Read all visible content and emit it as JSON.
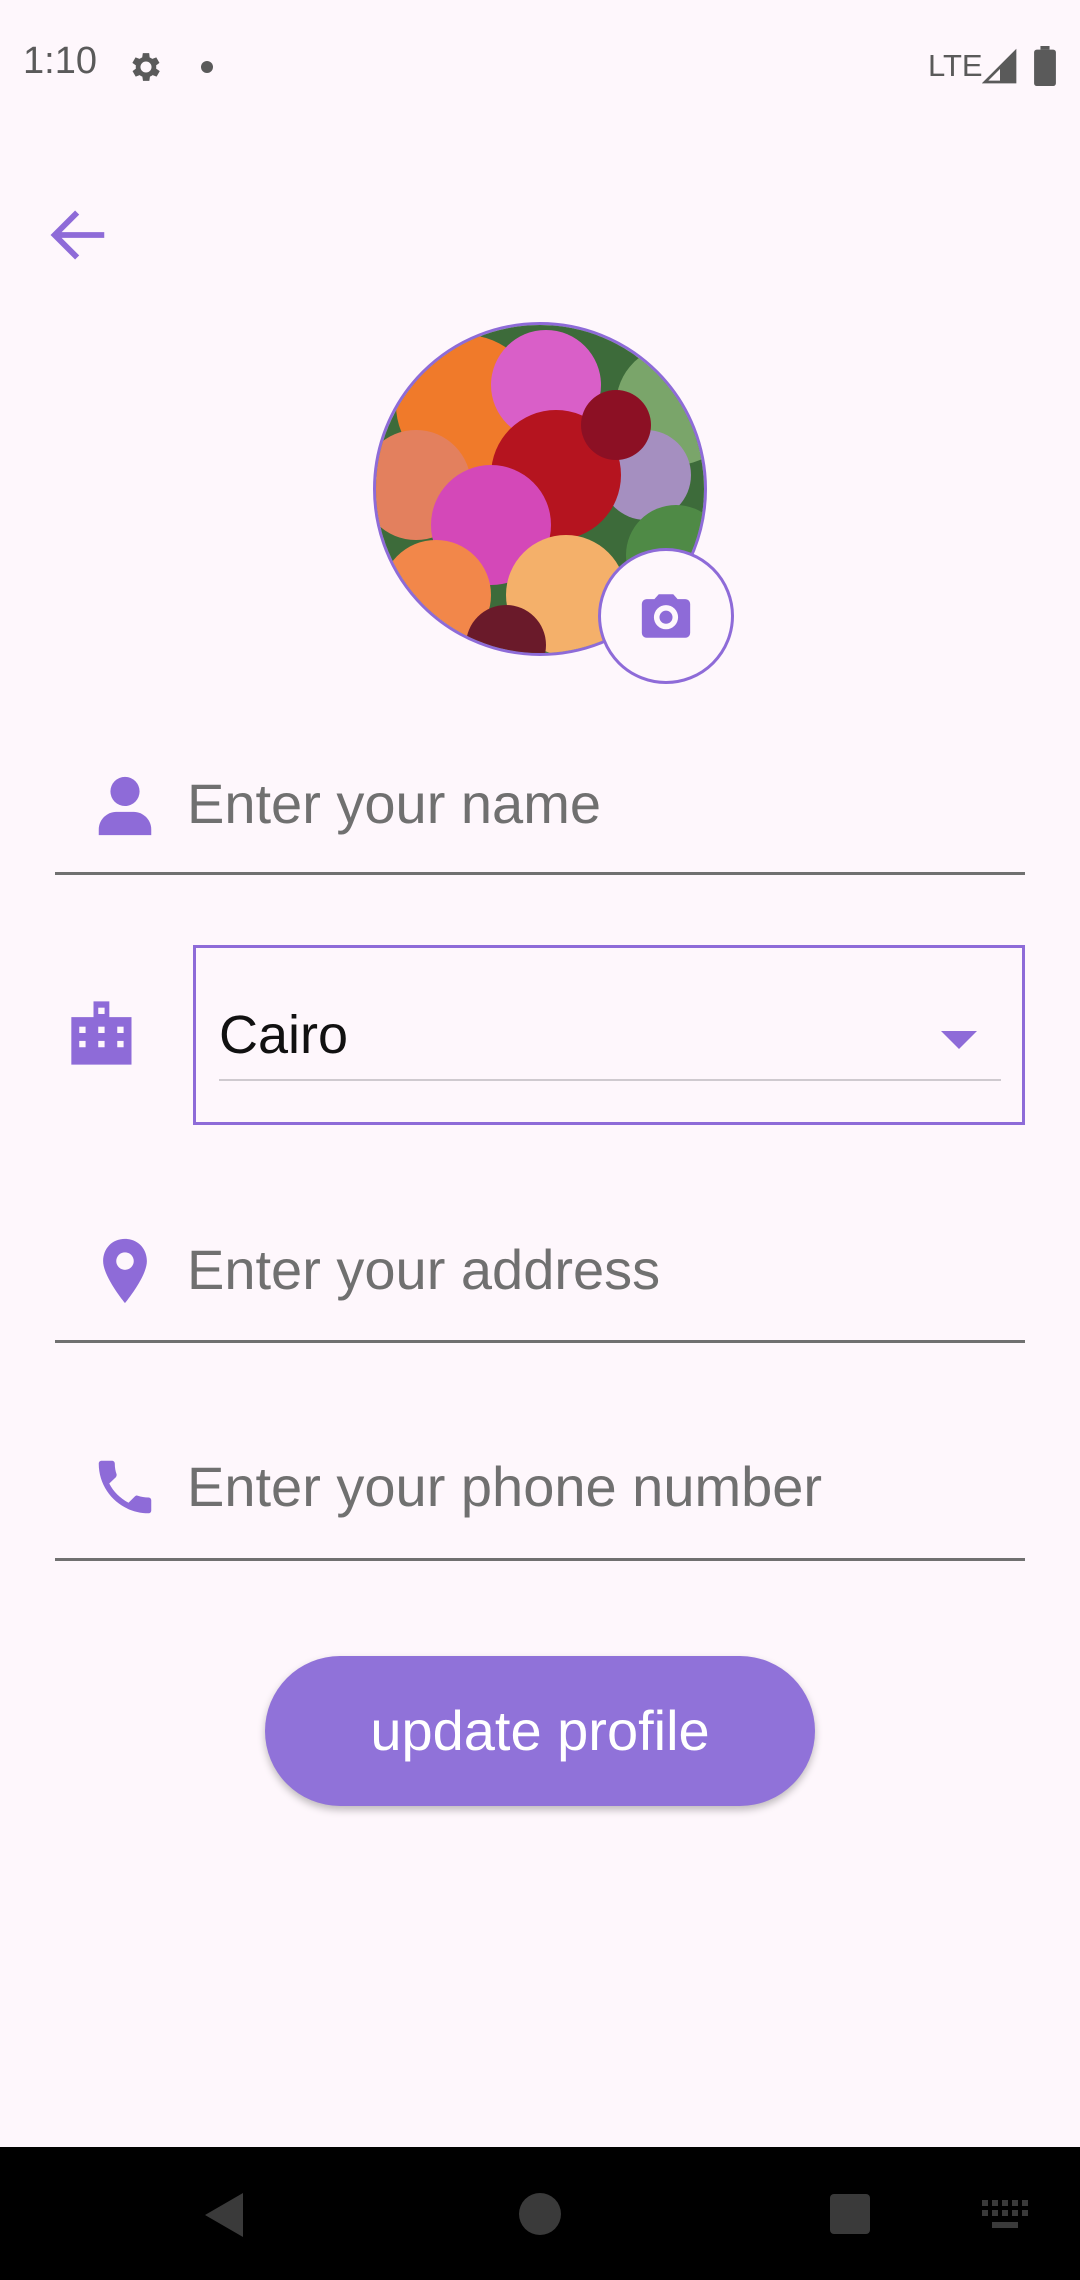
{
  "status_bar": {
    "time": "1:10",
    "network": "LTE",
    "icons": [
      "gear-icon",
      "dot-icon",
      "signal-icon",
      "battery-icon"
    ]
  },
  "header": {
    "back_icon": "arrow-left-icon"
  },
  "avatar": {
    "description_icon": "camera-icon"
  },
  "form": {
    "name_placeholder": "Enter your name",
    "city_value": "Cairo",
    "address_placeholder": "Enter your address",
    "phone_placeholder": "Enter your phone number"
  },
  "actions": {
    "update_label": "update profile"
  },
  "colors": {
    "accent": "#8E6BD8",
    "button": "#9072D9",
    "background": "#FEF7FC"
  }
}
